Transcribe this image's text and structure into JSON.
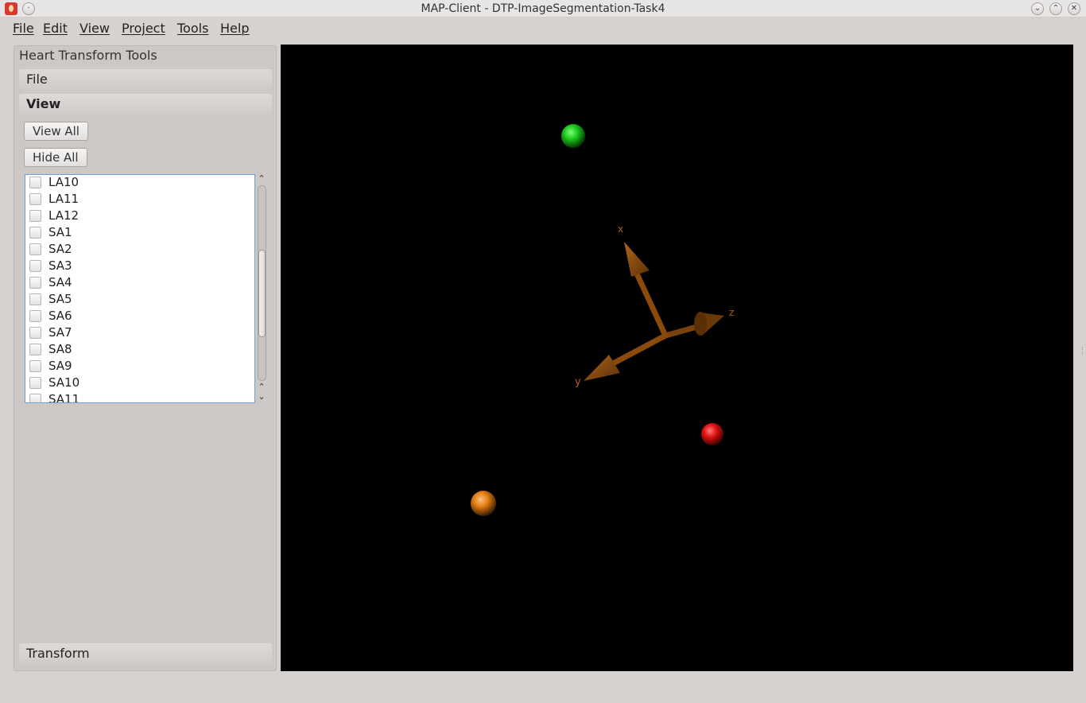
{
  "window": {
    "title": "MAP-Client - DTP-ImageSegmentation-Task4"
  },
  "menubar": {
    "items": [
      "File",
      "Edit",
      "View",
      "Project",
      "Tools",
      "Help"
    ]
  },
  "panel": {
    "title": "Heart Transform Tools",
    "sections": {
      "file": "File",
      "view": "View",
      "transform": "Transform"
    },
    "buttons": {
      "view_all": "View All",
      "hide_all": "Hide All"
    },
    "list_items": [
      "LA10",
      "LA11",
      "LA12",
      "SA1",
      "SA2",
      "SA3",
      "SA4",
      "SA5",
      "SA6",
      "SA7",
      "SA8",
      "SA9",
      "SA10",
      "SA11"
    ]
  },
  "viewport": {
    "axes": {
      "x_label": "x",
      "y_label": "y",
      "z_label": "z",
      "color": "#8a4a0c"
    },
    "spheres": [
      {
        "name": "green-sphere",
        "color": "#19c619"
      },
      {
        "name": "red-sphere",
        "color": "#e01010"
      },
      {
        "name": "orange-sphere",
        "color": "#e07a10"
      }
    ]
  }
}
